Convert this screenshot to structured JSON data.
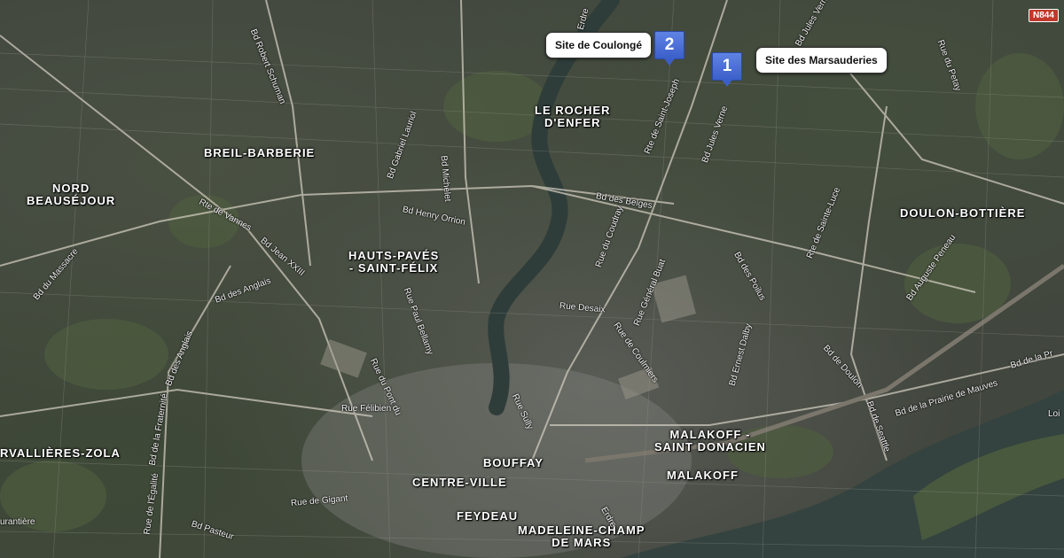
{
  "map": {
    "markers": [
      {
        "number": "1",
        "label": "Site des Marsauderies"
      },
      {
        "number": "2",
        "label": "Site de Coulongé"
      }
    ],
    "road_shield": "N844",
    "districts": {
      "breil": "BREIL-BARBERIE",
      "nord": "NORD\nBEAUSÉJOUR",
      "rocher": "LE ROCHER\nD'ENFER",
      "hauts": "HAUTS-PAVÉS\n- SAINT-FÉLIX",
      "doulon": "DOULON-BOTTIÈRE",
      "malakoff_sd": "MALAKOFF -\nSAINT DONACIEN",
      "malakoff": "MALAKOFF",
      "bouffay": "BOUFFAY",
      "centre": "CENTRE-VILLE",
      "feydeau": "FEYDEAU",
      "madeleine": "MADELEINE-CHAMP\nDE MARS",
      "zola": "RVALLIÈRES-ZOLA"
    },
    "streets": {
      "robert_schuman": "Bd Robert Schuman",
      "gabriel_lauriol": "Bd Gabriel Lauriol",
      "michelet": "Bd Michelet",
      "erdre_top": "Erdre",
      "jules_verne_top": "Bd Jules Verne",
      "jules_verne": "Bd Jules Verne",
      "saint_joseph": "Rte de Saint-Joseph",
      "du_petay": "Rue du Petay",
      "vannes": "Rte de Vannes",
      "jean_xxiii": "Bd Jean XXIII",
      "henry_orrion": "Bd Henry Orrion",
      "beiges": "Bd des Belges",
      "du_coudray": "Rue du Coudray",
      "general_buat": "Rue Général Buat",
      "sainte_luce": "Rte de Sainte-Luce",
      "des_poilus": "Bd des Poilus",
      "auguste_peneau": "Bd Auguste Peneau",
      "du_massacre": "Bd du Massacre",
      "des_anglais": "Bd des Anglais",
      "paul_bellamy": "Rue Paul Bellamy",
      "desaix": "Rue Desaix",
      "coulmiers": "Rue de Coulmiers",
      "ernest_dalby": "Bd Ernest Dalby",
      "doulon": "Bd de Doulon",
      "seattle": "Bd de Seattle",
      "prairie_mauves": "Bd de la Prairie de Mauves",
      "bd_de_la_pr": "Bd de la Pr",
      "des_anglais_2": "Bd des Anglais",
      "du_pont_du": "Rue du Pont du",
      "felibien": "Rue Félibien",
      "sully": "Rue Sully",
      "fraternite": "Bd de la Fraternité",
      "gigant": "Rue de Gigant",
      "egalite": "Rue de l'Égalité",
      "pasteur": "Bd Pasteur",
      "erdre_bottom": "Erdre",
      "quarantiere": "urantière",
      "loire_edge": "Loi"
    },
    "colors": {
      "marker_blue": "#4a6fd6",
      "river": "#2d3e3a",
      "road": "#d8d4c8"
    }
  }
}
